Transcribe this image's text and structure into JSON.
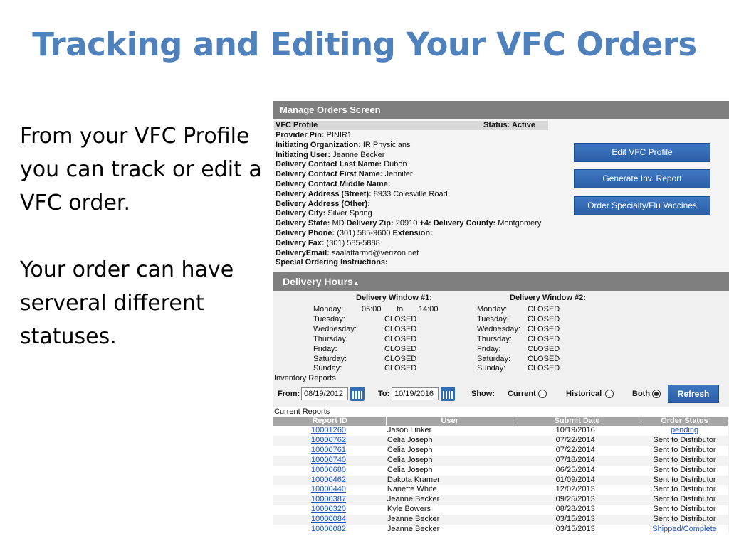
{
  "slide": {
    "title": "Tracking and Editing Your VFC Orders",
    "para1": "From your VFC Profile you can track or edit a VFC order.",
    "para2": "Your order can have serveral different statuses."
  },
  "app": {
    "header": "Manage Orders Screen",
    "profile": {
      "heading": "VFC Profile",
      "status_label": "Status:",
      "status_value": "Active",
      "lines": [
        {
          "label": "Provider Pin:",
          "value": "PINIR1"
        },
        {
          "label": "Initiating Organization:",
          "value": "IR Physicians"
        },
        {
          "label": "Initiating User:",
          "value": "Jeanne Becker"
        },
        {
          "label": "Delivery Contact Last Name:",
          "value": "Dubon"
        },
        {
          "label": "Delivery Contact First Name:",
          "value": "Jennifer"
        },
        {
          "label": "Delivery Contact Middle Name:",
          "value": ""
        },
        {
          "label": "Delivery Address (Street):",
          "value": "8933 Colesville Road"
        },
        {
          "label": "Delivery Address (Other):",
          "value": ""
        },
        {
          "label": "Delivery City:",
          "value": "Silver Spring"
        },
        {
          "label": "Delivery State:",
          "value": "MD",
          "label2": "Delivery Zip:",
          "value2": "20910",
          "label3": "+4:",
          "label4": "Delivery County:",
          "value4": "Montgomery"
        },
        {
          "label": "Delivery Phone:",
          "value": "(301) 585-9600",
          "label2": "Extension:"
        },
        {
          "label": "Delivery Fax:",
          "value": "(301) 585-5888"
        },
        {
          "label": "DeliveryEmail:",
          "value": "saalattarmd@verizon.net"
        },
        {
          "label": "Special Ordering Instructions:",
          "value": ""
        }
      ],
      "buttons": {
        "edit": "Edit VFC Profile",
        "generate": "Generate Inv. Report",
        "order": "Order Specialty/Flu Vaccines"
      }
    },
    "delivery_hours": {
      "title": "Delivery Hours",
      "window1_title": "Delivery Window #1:",
      "window2_title": "Delivery Window #2:",
      "window1": [
        {
          "day": "Monday:",
          "from": "05:00",
          "to_word": "to",
          "to": "14:00"
        },
        {
          "day": "Tuesday:",
          "value": "CLOSED"
        },
        {
          "day": "Wednesday:",
          "value": "CLOSED"
        },
        {
          "day": "Thursday:",
          "value": "CLOSED"
        },
        {
          "day": "Friday:",
          "value": "CLOSED"
        },
        {
          "day": "Saturday:",
          "value": "CLOSED"
        },
        {
          "day": "Sunday:",
          "value": "CLOSED"
        }
      ],
      "window2": [
        {
          "day": "Monday:",
          "value": "CLOSED"
        },
        {
          "day": "Tuesday:",
          "value": "CLOSED"
        },
        {
          "day": "Wednesday:",
          "value": "CLOSED"
        },
        {
          "day": "Thursday:",
          "value": "CLOSED"
        },
        {
          "day": "Friday:",
          "value": "CLOSED"
        },
        {
          "day": "Saturday:",
          "value": "CLOSED"
        },
        {
          "day": "Sunday:",
          "value": "CLOSED"
        }
      ]
    },
    "inventory": {
      "label": "Inventory Reports",
      "from_label": "From:",
      "from_value": "08/19/2012",
      "to_label": "To:",
      "to_value": "10/19/2016",
      "show_label": "Show:",
      "current_label": "Current",
      "historical_label": "Historical",
      "both_label": "Both",
      "selected": "Both",
      "refresh": "Refresh"
    },
    "current_reports": {
      "label": "Current Reports",
      "columns": [
        "Report ID",
        "User",
        "Submit Date",
        "Order Status"
      ],
      "rows": [
        {
          "id": "10001260",
          "user": "Jason Linker",
          "date": "10/19/2016",
          "status": "pending",
          "status_link": true
        },
        {
          "id": "10000762",
          "user": "Celia Joseph",
          "date": "07/22/2014",
          "status": "Sent to Distributor",
          "status_link": false
        },
        {
          "id": "10000761",
          "user": "Celia Joseph",
          "date": "07/22/2014",
          "status": "Sent to Distributor",
          "status_link": false
        },
        {
          "id": "10000740",
          "user": "Celia Joseph",
          "date": "07/18/2014",
          "status": "Sent to Distributor",
          "status_link": false
        },
        {
          "id": "10000680",
          "user": "Celia Joseph",
          "date": "06/25/2014",
          "status": "Sent to Distributor",
          "status_link": false
        },
        {
          "id": "10000462",
          "user": "Dakota Kramer",
          "date": "01/09/2014",
          "status": "Sent to Distributor",
          "status_link": false
        },
        {
          "id": "10000440",
          "user": "Nanette White",
          "date": "12/02/2013",
          "status": "Sent to Distributor",
          "status_link": false
        },
        {
          "id": "10000387",
          "user": "Jeanne Becker",
          "date": "09/25/2013",
          "status": "Sent to Distributor",
          "status_link": false
        },
        {
          "id": "10000320",
          "user": "Kyle Bowers",
          "date": "08/28/2013",
          "status": "Sent to Distributor",
          "status_link": false
        },
        {
          "id": "10000084",
          "user": "Jeanne Becker",
          "date": "03/15/2013",
          "status": "Sent to Distributor",
          "status_link": false
        },
        {
          "id": "10000082",
          "user": "Jeanne Becker",
          "date": "03/15/2013",
          "status": "Shipped/Complete",
          "status_link": true
        }
      ]
    }
  }
}
